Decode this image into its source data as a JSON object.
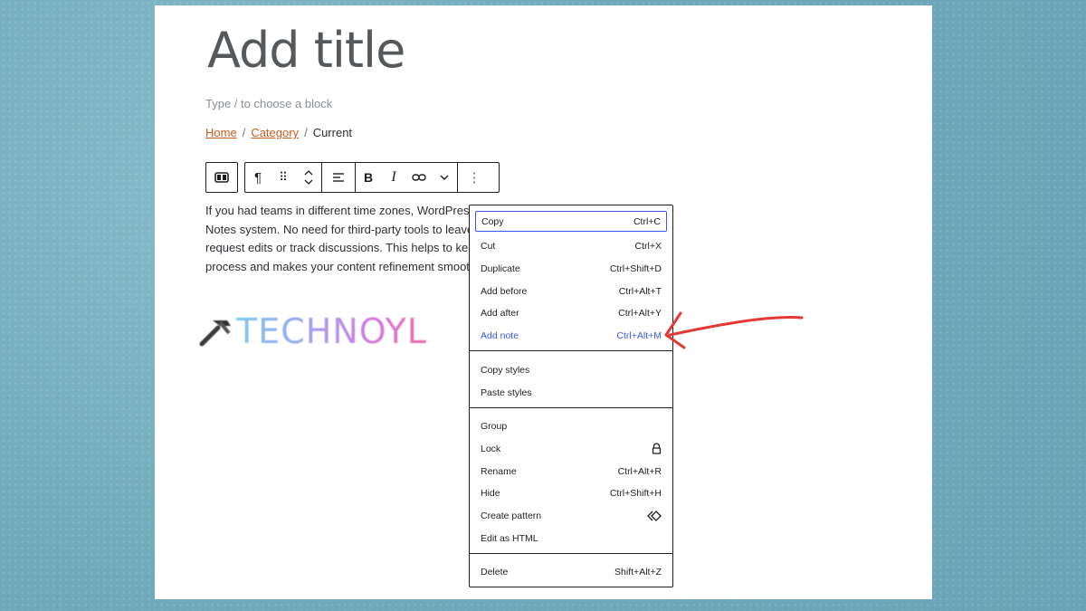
{
  "page": {
    "title": "Add title",
    "placeholder": "Type / to choose a block"
  },
  "breadcrumb": {
    "home": "Home",
    "category": "Category",
    "current": "Current",
    "separator": "/"
  },
  "toolbar": {
    "paragraph_icon": "¶",
    "drag_icon": "⠿",
    "align_icon": "align-left-icon",
    "bold": "B",
    "italic": "I",
    "more_icon": "⋮"
  },
  "content": {
    "lines": [
      "If you had teams in different time zones, WordPress",
      "Notes system. No need for third-party tools to leave",
      "request edits or track discussions. This helps to keep",
      "process and makes your content refinement smooth"
    ]
  },
  "logo": {
    "text": "TECHNOYL"
  },
  "menu": {
    "group1": [
      {
        "label": "Copy",
        "shortcut": "Ctrl+C"
      },
      {
        "label": "Cut",
        "shortcut": "Ctrl+X"
      },
      {
        "label": "Duplicate",
        "shortcut": "Ctrl+Shift+D"
      },
      {
        "label": "Add before",
        "shortcut": "Ctrl+Alt+T"
      },
      {
        "label": "Add after",
        "shortcut": "Ctrl+Alt+Y"
      },
      {
        "label": "Add note",
        "shortcut": "Ctrl+Alt+M"
      }
    ],
    "group2": [
      {
        "label": "Copy styles"
      },
      {
        "label": "Paste styles"
      }
    ],
    "group3": [
      {
        "label": "Group"
      },
      {
        "label": "Lock",
        "icon": "lock-icon"
      },
      {
        "label": "Rename",
        "shortcut": "Ctrl+Alt+R"
      },
      {
        "label": "Hide",
        "shortcut": "Ctrl+Shift+H"
      },
      {
        "label": "Create pattern",
        "icon": "pattern-icon"
      },
      {
        "label": "Edit as HTML"
      }
    ],
    "group4": [
      {
        "label": "Delete",
        "shortcut": "Shift+Alt+Z"
      }
    ]
  },
  "colors": {
    "accent": "#3858e9",
    "link": "#c75d1e",
    "annotation_arrow": "#e53935"
  }
}
